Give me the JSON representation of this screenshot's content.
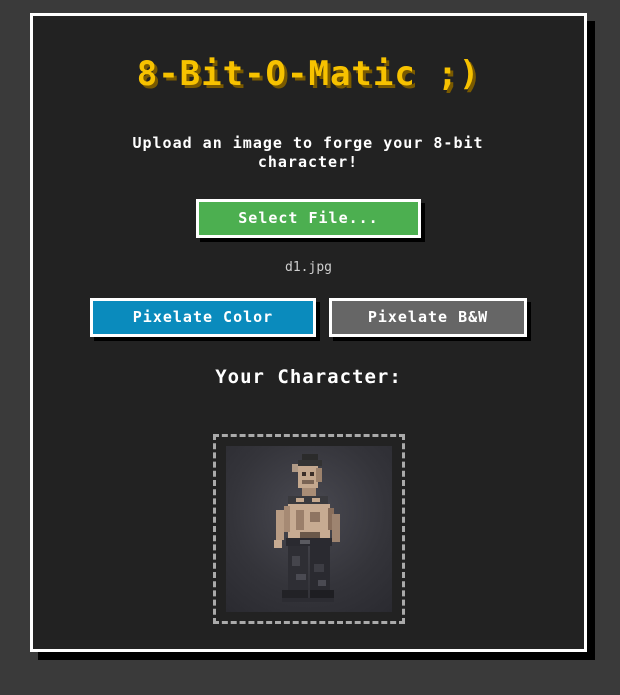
{
  "app": {
    "title": "8-Bit-O-Matic ;)",
    "subtitle": "Upload an image to forge your 8-bit character!"
  },
  "upload": {
    "select_label": "Select File...",
    "filename": "d1.jpg"
  },
  "actions": {
    "color_label": "Pixelate Color",
    "bw_label": "Pixelate B&W"
  },
  "result": {
    "heading": "Your Character:"
  },
  "colors": {
    "title": "#f7c200",
    "select_button": "#4caf50",
    "color_button": "#0a8bbd",
    "bw_button": "#666666",
    "panel": "#222222"
  }
}
